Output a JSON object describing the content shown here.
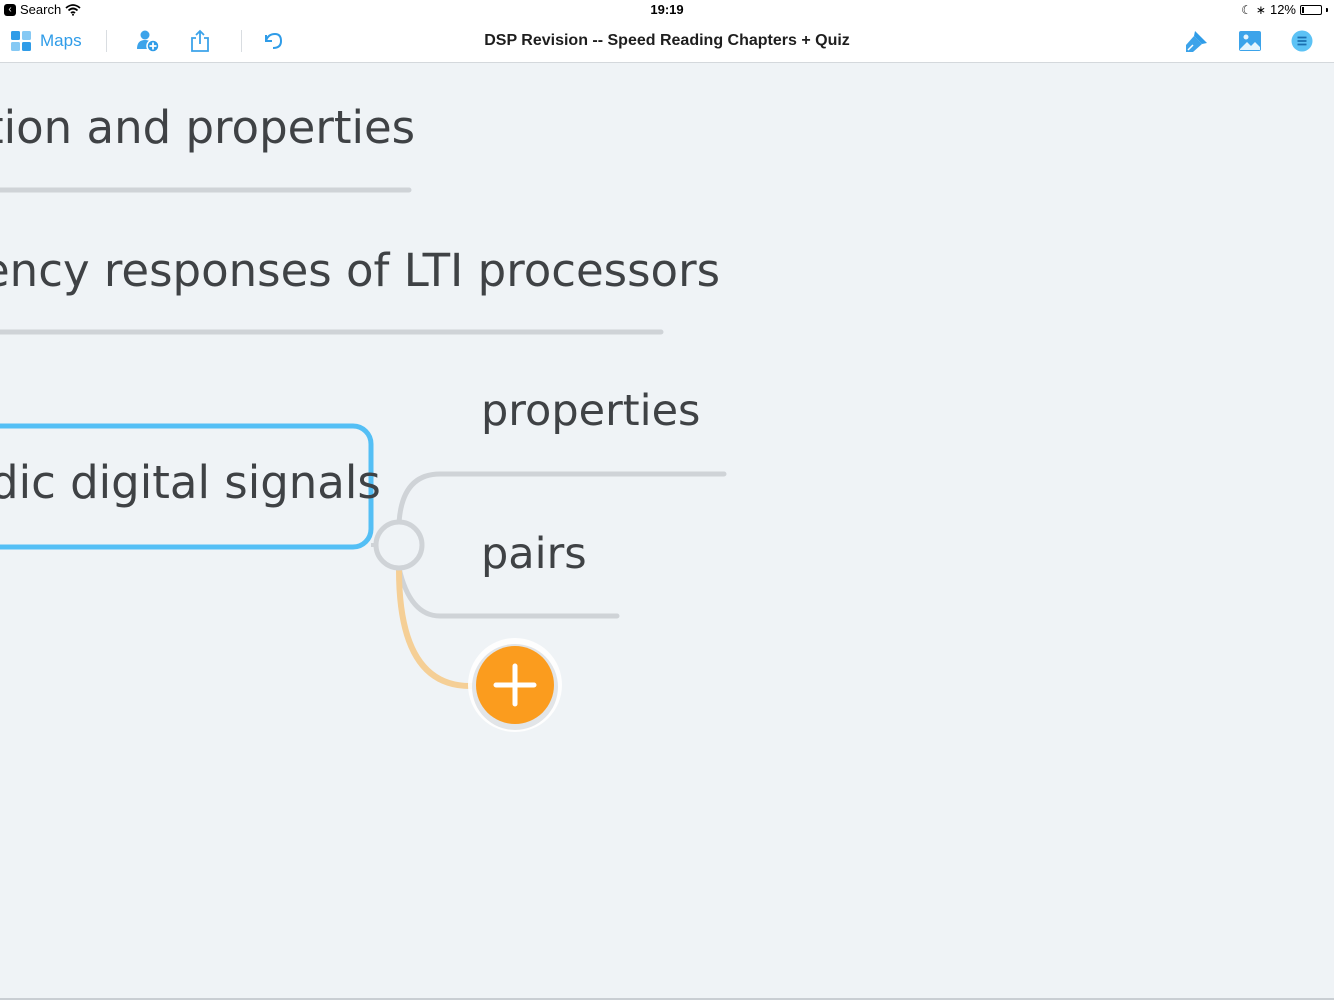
{
  "status_bar": {
    "back_app": "Search",
    "time": "19:19",
    "battery": "12%",
    "battery_level": 0.12
  },
  "toolbar": {
    "maps_label": "Maps",
    "document_title": "DSP Revision -- Speed Reading Chapters + Quiz",
    "icons": [
      "maps-grid-icon",
      "add-person-icon",
      "share-icon",
      "undo-icon",
      "style-brush-icon",
      "insert-image-icon",
      "outline-menu-icon"
    ],
    "accent_color": "#2f9ce8"
  },
  "mind_map": {
    "branches": [
      {
        "label": "tion and properties"
      },
      {
        "label": "ency responses of LTI processors"
      },
      {
        "label": "dic digital signals",
        "selected": true
      }
    ],
    "subtopics": [
      {
        "label": "properties"
      },
      {
        "label": "pairs"
      }
    ],
    "colors": {
      "selected_border": "#54bff5",
      "line": "#cfd3d7",
      "add_button": "#fb9c1e",
      "add_connector": "#f5cf96"
    }
  }
}
